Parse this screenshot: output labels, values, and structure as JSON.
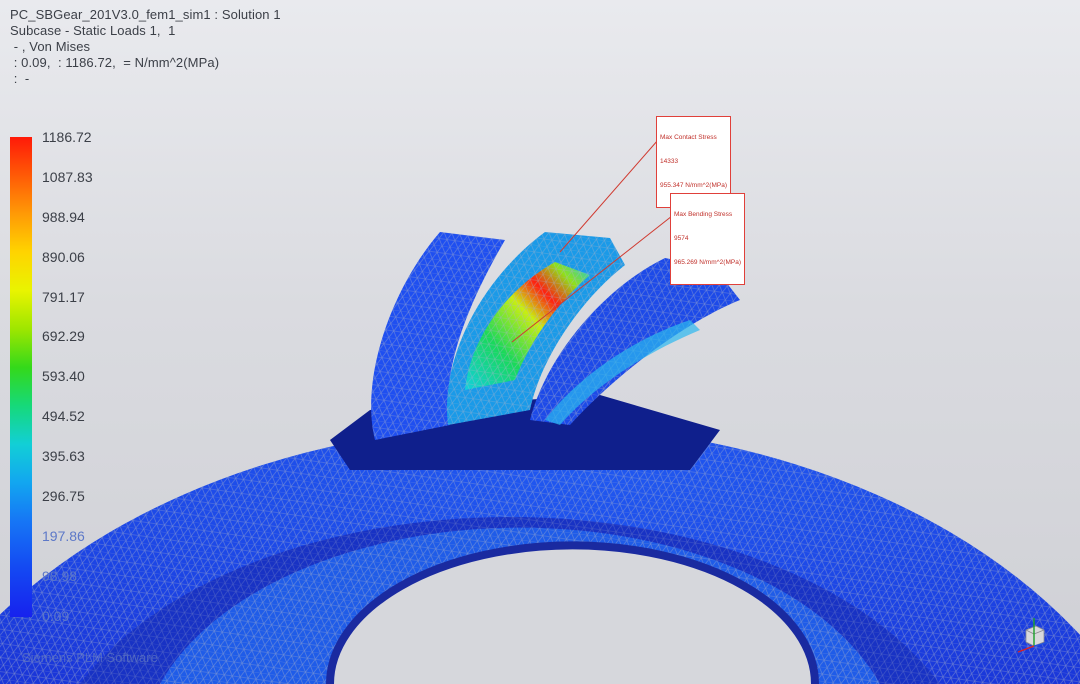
{
  "header": {
    "line1": "PC_SBGear_201V3.0_fem1_sim1 : Solution 1",
    "line2": "Subcase - Static Loads 1,  1",
    "line3": " - , Von Mises",
    "line4": " : 0.09,  : 1186.72,  = N/mm^2(MPa)",
    "line5": " :  -"
  },
  "legend": {
    "values": [
      "1186.72",
      "1087.83",
      "988.94",
      "890.06",
      "791.17",
      "692.29",
      "593.40",
      "494.52",
      "395.63",
      "296.75",
      "197.86",
      "98.98",
      "0.09"
    ],
    "colors": [
      "#ff1a08",
      "#ff5a06",
      "#ff9a06",
      "#ffd400",
      "#e9f400",
      "#9ee600",
      "#34d91a",
      "#16d97a",
      "#12cfd6",
      "#12a6f0",
      "#1676f5",
      "#1448f2",
      "#1722ee"
    ]
  },
  "callouts": {
    "contact": {
      "title": "Max Contact Stress",
      "node": "14333",
      "value": "955.347 N/mm^2(MPa)"
    },
    "bending": {
      "title": "Max Bending Stress",
      "node": "9574",
      "value": "965.269 N/mm^2(MPa)"
    }
  },
  "footer": {
    "text": "Siemens PLM Software"
  },
  "triad_icon": "coordinate-triad-icon",
  "model_colors": {
    "base": "#1a3fe0",
    "accent": "#ff1a08",
    "mesh": "#9aa4b8"
  }
}
